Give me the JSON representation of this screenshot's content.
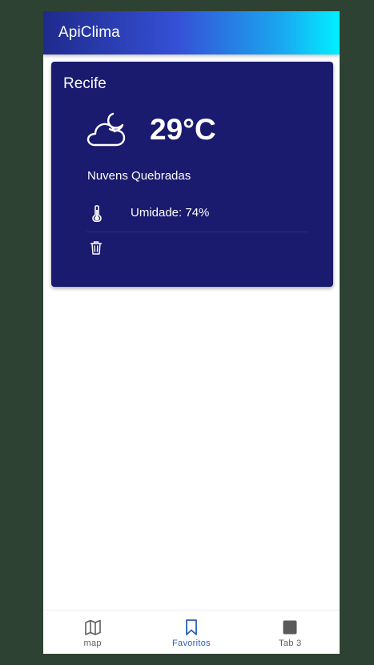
{
  "app": {
    "title": "ApiClima"
  },
  "favorite_card": {
    "city": "Recife",
    "weather_icon": "cloud-moon-icon",
    "temperature": "29°C",
    "description": "Nuvens Quebradas",
    "humidity_label": "Umidade: 74%",
    "humidity_icon": "thermometer-icon",
    "delete_icon": "trash-icon",
    "background_color": "#1a1a6e"
  },
  "tabs": [
    {
      "label": "map",
      "icon": "map-icon",
      "active": false
    },
    {
      "label": "Favoritos",
      "icon": "bookmark-icon",
      "active": true
    },
    {
      "label": "Tab 3",
      "icon": "square-icon",
      "active": false
    }
  ],
  "colors": {
    "header_gradient_start": "#1f2a8c",
    "header_gradient_end": "#00f0ff",
    "active_tab": "#2c5fb8",
    "page_background": "#2e4233"
  }
}
